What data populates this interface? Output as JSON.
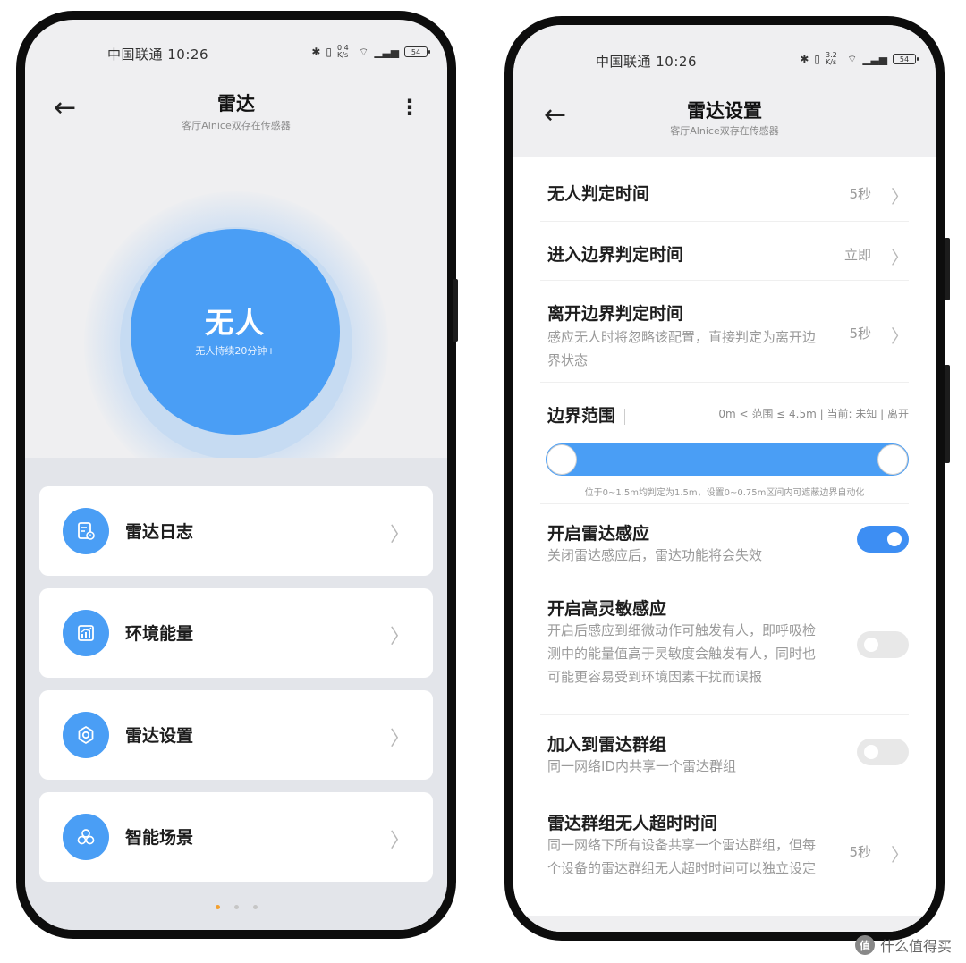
{
  "status_left": {
    "carrier_time": "中国联通 10:26",
    "net_speed": "0.4 K/s",
    "battery": "54"
  },
  "status_right": {
    "carrier_time": "中国联通 10:26",
    "net_speed": "3.2 K/s",
    "battery": "54"
  },
  "left": {
    "title": "雷达",
    "subtitle": "客厅Alnice双存在传感器",
    "back_glyph": "←",
    "more_glyph": "⋮",
    "status_main": "无人",
    "status_sub": "无人持续20分钟+",
    "menu": [
      {
        "label": "雷达日志",
        "icon": "log-icon"
      },
      {
        "label": "环境能量",
        "icon": "chart-icon"
      },
      {
        "label": "雷达设置",
        "icon": "gear-icon"
      },
      {
        "label": "智能场景",
        "icon": "scene-icon"
      }
    ],
    "chevron": "〉",
    "page_indicator": {
      "count": 3,
      "active": 0
    }
  },
  "right": {
    "title": "雷达设置",
    "subtitle": "客厅Alnice双存在传感器",
    "back_glyph": "←",
    "chevron": "〉",
    "rows": {
      "no_person_time": {
        "title": "无人判定时间",
        "value": "5秒"
      },
      "enter_border": {
        "title": "进入边界判定时间",
        "value": "立即"
      },
      "leave_border": {
        "title": "离开边界判定时间",
        "desc": "感应无人时将忽略该配置，直接判定为离开边界状态",
        "value": "5秒"
      },
      "border_range": {
        "title": "边界范围",
        "info": "0m < 范围 ≤ 4.5m | 当前: 未知 | 离开",
        "note": "位于0~1.5m均判定为1.5m，设置0~0.75m区间内可遮蔽边界自动化"
      },
      "radar_sense": {
        "title": "开启雷达感应",
        "desc": "关闭雷达感应后，雷达功能将会失效",
        "enabled": true
      },
      "high_sense": {
        "title": "开启高灵敏感应",
        "desc": "开启后感应到细微动作可触发有人，即呼吸检测中的能量值高于灵敏度会触发有人，同时也可能更容易受到环境因素干扰而误报",
        "enabled": false
      },
      "radar_group": {
        "title": "加入到雷达群组",
        "desc": "同一网络ID内共享一个雷达群组",
        "enabled": false
      },
      "group_timeout": {
        "title": "雷达群组无人超时时间",
        "desc": "同一网络下所有设备共享一个雷达群组，但每个设备的雷达群组无人超时时间可以独立设定",
        "value": "5秒"
      }
    }
  },
  "watermark": {
    "badge": "值",
    "text": "什么值得买"
  },
  "colors": {
    "accent": "#4a9ef5",
    "toggle_on": "#3d8ef3",
    "indicator_active": "#f3a030"
  }
}
